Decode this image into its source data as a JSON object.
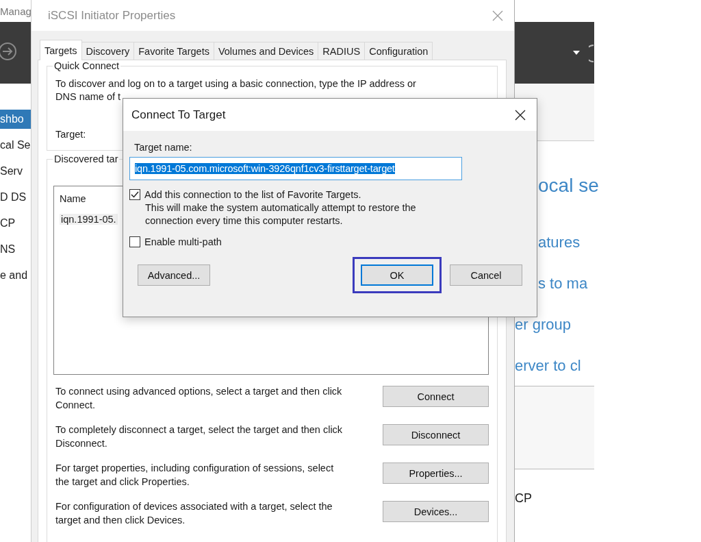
{
  "background_window": {
    "title": "Manag",
    "nav_items": [
      {
        "label": "shbo",
        "selected": true
      },
      {
        "label": "cal Se",
        "selected": false
      },
      {
        "label": "Serv",
        "selected": false
      },
      {
        "label": "D DS",
        "selected": false
      },
      {
        "label": "CP",
        "selected": false
      },
      {
        "label": "NS",
        "selected": false
      },
      {
        "label": "e and",
        "selected": false
      }
    ],
    "content_lines": [
      "ocal se",
      "atures",
      "s to ma",
      "er group",
      "erver to cl"
    ],
    "footer_text": "CP"
  },
  "iscsi_dialog": {
    "title": "iSCSI Initiator Properties",
    "tabs": [
      {
        "label": "Targets",
        "selected": true
      },
      {
        "label": "Discovery",
        "selected": false
      },
      {
        "label": "Favorite Targets",
        "selected": false
      },
      {
        "label": "Volumes and Devices",
        "selected": false
      },
      {
        "label": "RADIUS",
        "selected": false
      },
      {
        "label": "Configuration",
        "selected": false
      }
    ],
    "quick_connect": {
      "legend": "Quick Connect",
      "text_lines": [
        "To discover and log on to a target using a basic connection, type the IP address or",
        "DNS name of t"
      ],
      "target_label": "Target:"
    },
    "discovered": {
      "legend": "Discovered tar",
      "column": "Name",
      "rows": [
        {
          "name": "iqn.1991-05.",
          "selected": true
        }
      ]
    },
    "actions": [
      {
        "text": "To connect using advanced options, select a target and then click Connect.",
        "button": "Connect"
      },
      {
        "text": "To completely disconnect a target, select the target and then click Disconnect.",
        "button": "Disconnect"
      },
      {
        "text": "For target properties, including configuration of sessions, select the target and click Properties.",
        "button": "Properties..."
      },
      {
        "text": "For configuration of devices associated with a target, select the target and then click Devices.",
        "button": "Devices..."
      }
    ]
  },
  "connect_dialog": {
    "title": "Connect To Target",
    "target_label": "Target name:",
    "target_value": "iqn.1991-05.com.microsoft:win-3926qnf1cv3-firsttarget-target",
    "options": [
      {
        "label": "Add this connection to the list of Favorite Targets.",
        "checked": true,
        "description": "This will make the system automatically attempt to restore the connection every time this computer restarts."
      },
      {
        "label": "Enable multi-path",
        "checked": false
      }
    ],
    "buttons": [
      {
        "label": "Advanced...",
        "focused": false,
        "highlighted": false
      },
      {
        "label": "OK",
        "focused": true,
        "highlighted": true
      },
      {
        "label": "Cancel",
        "focused": false,
        "highlighted": false
      }
    ]
  }
}
